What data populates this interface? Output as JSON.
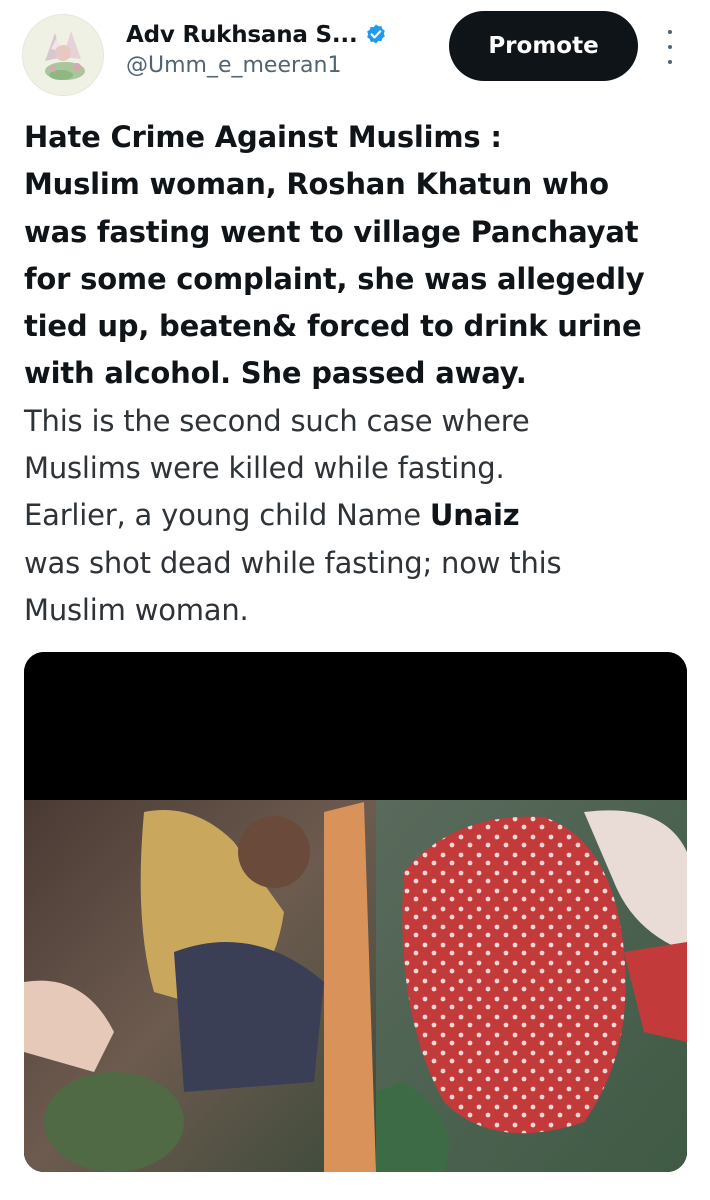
{
  "header": {
    "display_name": "Adv Rukhsana S...",
    "handle": "@Umm_e_meeran1",
    "verified": true,
    "promote_label": "Promote",
    "more_icon": "more-vertical-icon",
    "verified_color": "#1d9bf0"
  },
  "tweet": {
    "lines": {
      "l1": "Hate Crime Against Muslims :",
      "l2": "Muslim woman, Roshan Khatun who",
      "l3": "was fasting went to village Panchayat",
      "l4": "for some complaint, she was allegedly",
      "l5": "tied up, beaten& forced to drink urine",
      "l6": "with alcohol. She passed away.",
      "l7": "This is the second such case where",
      "l8": "Muslims were killed while fasting.",
      "l9_prefix": "Earlier, a young child  Name ",
      "l9_name": "Unaiz",
      "l10": "was shot dead while fasting; now this",
      "l11": "Muslim woman."
    }
  },
  "media": {
    "type": "video-thumbnail"
  }
}
